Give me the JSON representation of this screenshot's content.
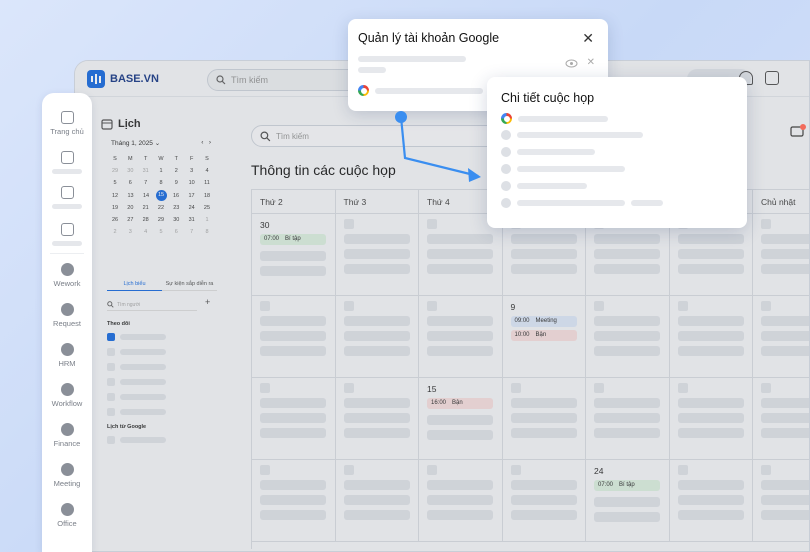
{
  "app": {
    "brand": "BASE.VN",
    "search_placeholder": "Tìm kiếm"
  },
  "nav": {
    "items": [
      {
        "label": "Trang chủ",
        "icon": "home-icon"
      },
      {
        "label": "",
        "icon": "chat-icon"
      },
      {
        "label": "",
        "icon": "calendar-icon"
      },
      {
        "label": "",
        "icon": "clipboard-icon"
      },
      {
        "label": "Wework",
        "icon": "wework-icon"
      },
      {
        "label": "Request",
        "icon": "request-icon"
      },
      {
        "label": "HRM",
        "icon": "hrm-icon"
      },
      {
        "label": "Workflow",
        "icon": "workflow-icon"
      },
      {
        "label": "Finance",
        "icon": "finance-icon"
      },
      {
        "label": "Meeting",
        "icon": "meeting-icon"
      },
      {
        "label": "Office",
        "icon": "office-icon"
      }
    ]
  },
  "sidebar": {
    "title": "Lịch",
    "month": "Tháng 1, 2025",
    "weekdays": [
      "S",
      "M",
      "T",
      "W",
      "T",
      "F",
      "S"
    ],
    "weeks": [
      [
        "29",
        "30",
        "31",
        "1",
        "2",
        "3",
        "4"
      ],
      [
        "5",
        "6",
        "7",
        "8",
        "9",
        "10",
        "11"
      ],
      [
        "12",
        "13",
        "14",
        "15",
        "16",
        "17",
        "18"
      ],
      [
        "19",
        "20",
        "21",
        "22",
        "23",
        "24",
        "25"
      ],
      [
        "26",
        "27",
        "28",
        "29",
        "30",
        "31",
        "1"
      ],
      [
        "2",
        "3",
        "4",
        "5",
        "6",
        "7",
        "8"
      ]
    ],
    "today": "15",
    "tabs": [
      "Lịch biểu",
      "Sự kiện sắp diễn ra"
    ],
    "search_placeholder": "Tìm người",
    "section_follow": "Theo dõi",
    "section_google": "Lịch từ Google"
  },
  "main": {
    "search_placeholder": "Tìm kiếm",
    "title": "Thông tin các cuộc họp",
    "days": [
      "Thứ 2",
      "Thứ 3",
      "Thứ 4",
      "",
      "",
      "",
      "Chủ nhật"
    ],
    "cells": {
      "mon_w1": {
        "num": "30",
        "event": {
          "time": "07:00",
          "label": "Bí tập"
        }
      },
      "fri_w2": {
        "num": "9",
        "events": [
          {
            "time": "09:00",
            "label": "Meeting"
          },
          {
            "time": "10:00",
            "label": "Bận"
          }
        ]
      },
      "wed_w3": {
        "num": "15",
        "event": {
          "time": "16:00",
          "label": "Bận"
        }
      },
      "sat_w4": {
        "num": "24",
        "event": {
          "time": "07:00",
          "label": "Bí tập"
        }
      }
    }
  },
  "panel_google": {
    "title": "Quản lý tài khoản Google"
  },
  "panel_meeting": {
    "title": "Chi tiết cuộc họp"
  },
  "colors": {
    "accent": "#1f6fe0",
    "connector": "#3a8ef0"
  }
}
